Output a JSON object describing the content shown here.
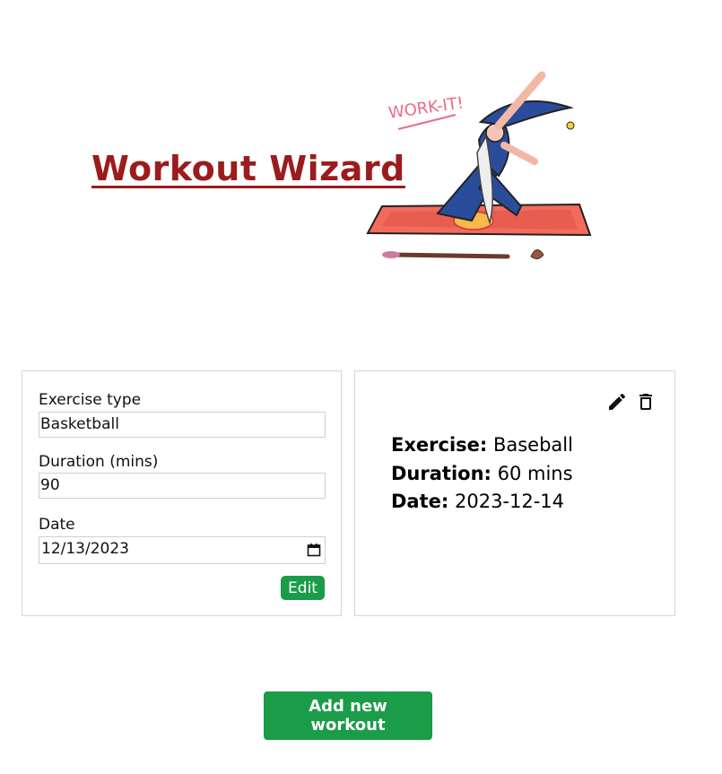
{
  "header": {
    "title": "Workout Wizard",
    "hero_text": "WORK-IT!"
  },
  "form": {
    "exercise_label": "Exercise type",
    "exercise_value": "Basketball",
    "duration_label": "Duration (mins)",
    "duration_value": "90",
    "date_label": "Date",
    "date_value": "12/13/2023",
    "edit_label": "Edit"
  },
  "workout": {
    "exercise_key": "Exercise:",
    "exercise_value": "Baseball",
    "duration_key": "Duration:",
    "duration_value": "60 mins",
    "date_key": "Date:",
    "date_value": "2023-12-14"
  },
  "actions": {
    "add_label": "Add new workout"
  },
  "colors": {
    "title": "#9b1c1c",
    "accent_green": "#1a9c48"
  },
  "icons": [
    "pencil-icon",
    "trash-icon",
    "calendar-icon"
  ]
}
